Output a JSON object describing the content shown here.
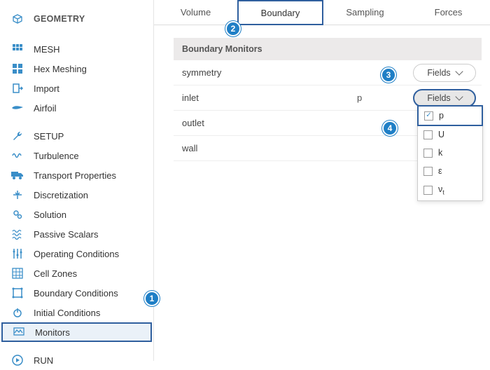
{
  "sidebar": {
    "sections": [
      {
        "title": "GEOMETRY",
        "items": []
      },
      {
        "title": "",
        "items": [
          {
            "label": "MESH",
            "name": "sidebar-item-mesh"
          },
          {
            "label": "Hex Meshing",
            "name": "sidebar-item-hex-meshing"
          },
          {
            "label": "Import",
            "name": "sidebar-item-import"
          },
          {
            "label": "Airfoil",
            "name": "sidebar-item-airfoil"
          }
        ]
      },
      {
        "title": "",
        "items": [
          {
            "label": "SETUP",
            "name": "sidebar-item-setup"
          },
          {
            "label": "Turbulence",
            "name": "sidebar-item-turbulence"
          },
          {
            "label": "Transport Properties",
            "name": "sidebar-item-transport-properties"
          },
          {
            "label": "Discretization",
            "name": "sidebar-item-discretization"
          },
          {
            "label": "Solution",
            "name": "sidebar-item-solution"
          },
          {
            "label": "Passive Scalars",
            "name": "sidebar-item-passive-scalars"
          },
          {
            "label": "Operating Conditions",
            "name": "sidebar-item-operating-conditions"
          },
          {
            "label": "Cell Zones",
            "name": "sidebar-item-cell-zones"
          },
          {
            "label": "Boundary Conditions",
            "name": "sidebar-item-boundary-conditions"
          },
          {
            "label": "Initial Conditions",
            "name": "sidebar-item-initial-conditions"
          },
          {
            "label": "Monitors",
            "name": "sidebar-item-monitors",
            "selected": true
          }
        ]
      },
      {
        "title": "",
        "items": [
          {
            "label": "RUN",
            "name": "sidebar-item-run"
          }
        ]
      }
    ]
  },
  "tabs": [
    {
      "label": "Volume",
      "name": "tab-volume"
    },
    {
      "label": "Boundary",
      "name": "tab-boundary",
      "active": true
    },
    {
      "label": "Sampling",
      "name": "tab-sampling"
    },
    {
      "label": "Forces",
      "name": "tab-forces"
    }
  ],
  "panel": {
    "title": "Boundary Monitors",
    "rows": [
      {
        "label": "symmetry",
        "mid": "",
        "btn": "Fields"
      },
      {
        "label": "inlet",
        "mid": "p",
        "btn": "Fields",
        "highlight": true
      },
      {
        "label": "outlet",
        "mid": "",
        "btn": ""
      },
      {
        "label": "wall",
        "mid": "",
        "btn": ""
      }
    ]
  },
  "dropdown": {
    "items": [
      {
        "label": "p",
        "checked": true
      },
      {
        "label": "U",
        "checked": false
      },
      {
        "label": "k",
        "checked": false
      },
      {
        "label": "ε",
        "checked": false
      },
      {
        "label": "νt",
        "checked": false,
        "subscript": true
      }
    ]
  },
  "badges": {
    "1": "1",
    "2": "2",
    "3": "3",
    "4": "4"
  }
}
